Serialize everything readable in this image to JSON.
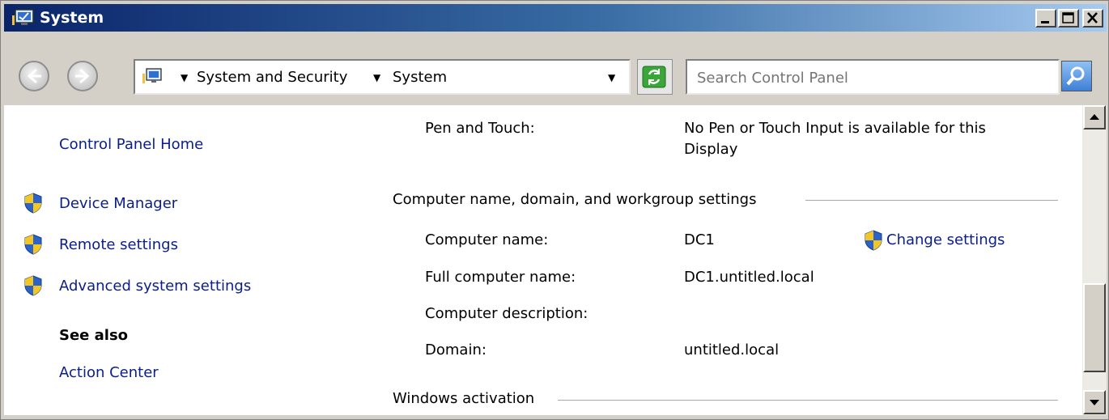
{
  "window": {
    "title": "System"
  },
  "address": {
    "crumbs": [
      "System and Security",
      "System"
    ]
  },
  "search": {
    "placeholder": "Search Control Panel"
  },
  "sidebar": {
    "home": "Control Panel Home",
    "links": [
      "Device Manager",
      "Remote settings",
      "Advanced system settings"
    ],
    "see_also_heading": "See also",
    "see_also": [
      "Action Center"
    ]
  },
  "main": {
    "pen_label": "Pen and Touch:",
    "pen_value_line1": "No Pen or Touch Input is available for this",
    "pen_value_line2": "Display",
    "section_computer": "Computer name, domain, and workgroup settings",
    "rows": [
      {
        "label": "Computer name:",
        "value": "DC1"
      },
      {
        "label": "Full computer name:",
        "value": "DC1.untitled.local"
      },
      {
        "label": "Computer description:",
        "value": ""
      },
      {
        "label": "Domain:",
        "value": "untitled.local"
      }
    ],
    "change_settings": "Change settings",
    "section_activation": "Windows activation"
  }
}
